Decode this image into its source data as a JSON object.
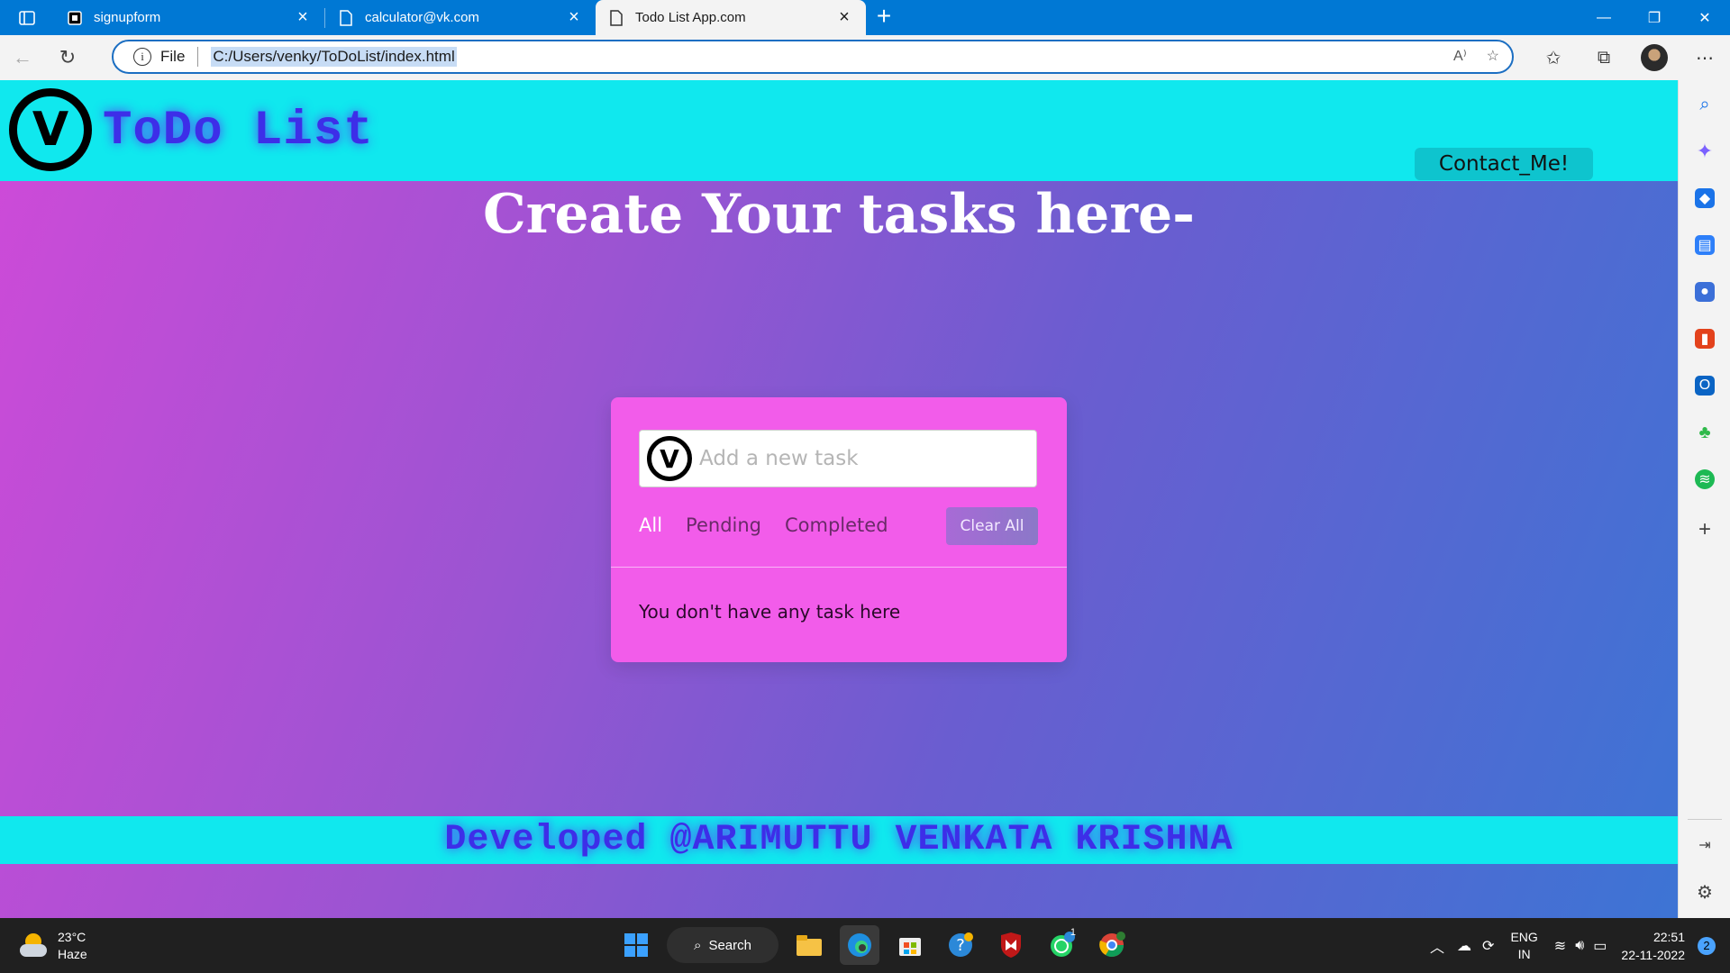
{
  "browser": {
    "tabs": [
      {
        "title": "signupform",
        "active": false
      },
      {
        "title": "calculator@vk.com",
        "active": false
      },
      {
        "title": "Todo List App.com",
        "active": true
      }
    ],
    "scheme_label": "File",
    "url": "C:/Users/venky/ToDoList/index.html"
  },
  "site": {
    "logo_letter": "V",
    "title": "ToDo List",
    "contact_label": "Contact_Me!",
    "hero": "Create Your tasks here-",
    "footer": "Developed @ARIMUTTU VENKATA KRISHNA"
  },
  "todo": {
    "input_placeholder": "Add a new task",
    "filters": [
      "All",
      "Pending",
      "Completed"
    ],
    "active_filter": "All",
    "clear_label": "Clear All",
    "empty_message": "You don't have any task here"
  },
  "taskbar": {
    "temperature": "23°C",
    "weather": "Haze",
    "search_label": "Search",
    "language_top": "ENG",
    "language_bottom": "IN",
    "time": "22:51",
    "date": "22-11-2022",
    "notification_count": "2",
    "whatsapp_badge": "1"
  },
  "colors": {
    "header_cyan": "#10e8ee",
    "title_blue": "#3d2ee8",
    "card_pink": "#f25cea",
    "edge_blue": "#0078d4"
  }
}
